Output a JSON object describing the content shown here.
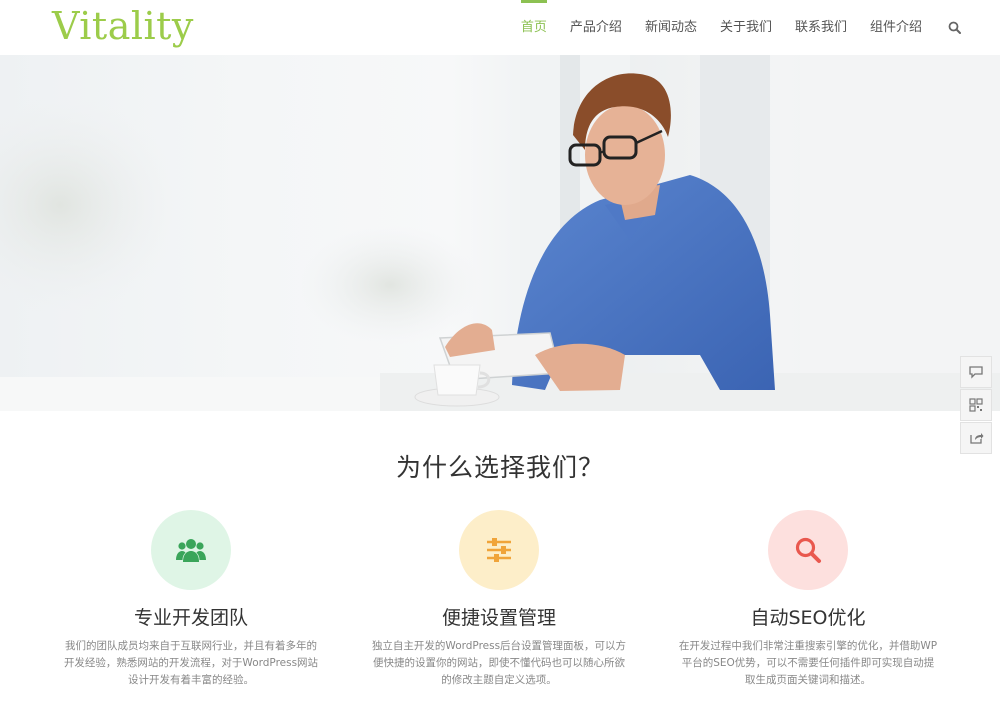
{
  "brand": {
    "logo_text": "Vitality",
    "accent_color": "#8cc152"
  },
  "nav": {
    "items": [
      {
        "label": "首页",
        "active": true
      },
      {
        "label": "产品介绍",
        "active": false
      },
      {
        "label": "新闻动态",
        "active": false
      },
      {
        "label": "关于我们",
        "active": false
      },
      {
        "label": "联系我们",
        "active": false
      },
      {
        "label": "组件介绍",
        "active": false
      }
    ],
    "search_icon": "search-icon"
  },
  "side_tools": {
    "icons": [
      "comment-icon",
      "qrcode-icon",
      "share-icon"
    ]
  },
  "why": {
    "title": "为什么选择我们？",
    "features": [
      {
        "icon": "users-icon",
        "icon_color": "#3aa55a",
        "bg_color": "#dff5e6",
        "title": "专业开发团队",
        "desc": "我们的团队成员均来自于互联网行业，并且有着多年的开发经验，熟悉网站的开发流程，对于WordPress网站设计开发有着丰富的经验。"
      },
      {
        "icon": "sliders-icon",
        "icon_color": "#f0a43a",
        "bg_color": "#fdeec9",
        "title": "便捷设置管理",
        "desc": "独立自主开发的WordPress后台设置管理面板，可以方便快捷的设置你的网站，即使不懂代码也可以随心所欲的修改主题自定义选项。"
      },
      {
        "icon": "search-icon",
        "icon_color": "#e9584e",
        "bg_color": "#fde0de",
        "title": "自动SEO优化",
        "desc": "在开发过程中我们非常注重搜索引擎的优化，并借助WP平台的SEO优势，可以不需要任何插件即可实现自动提取生成页面关键词和描述。"
      }
    ]
  }
}
